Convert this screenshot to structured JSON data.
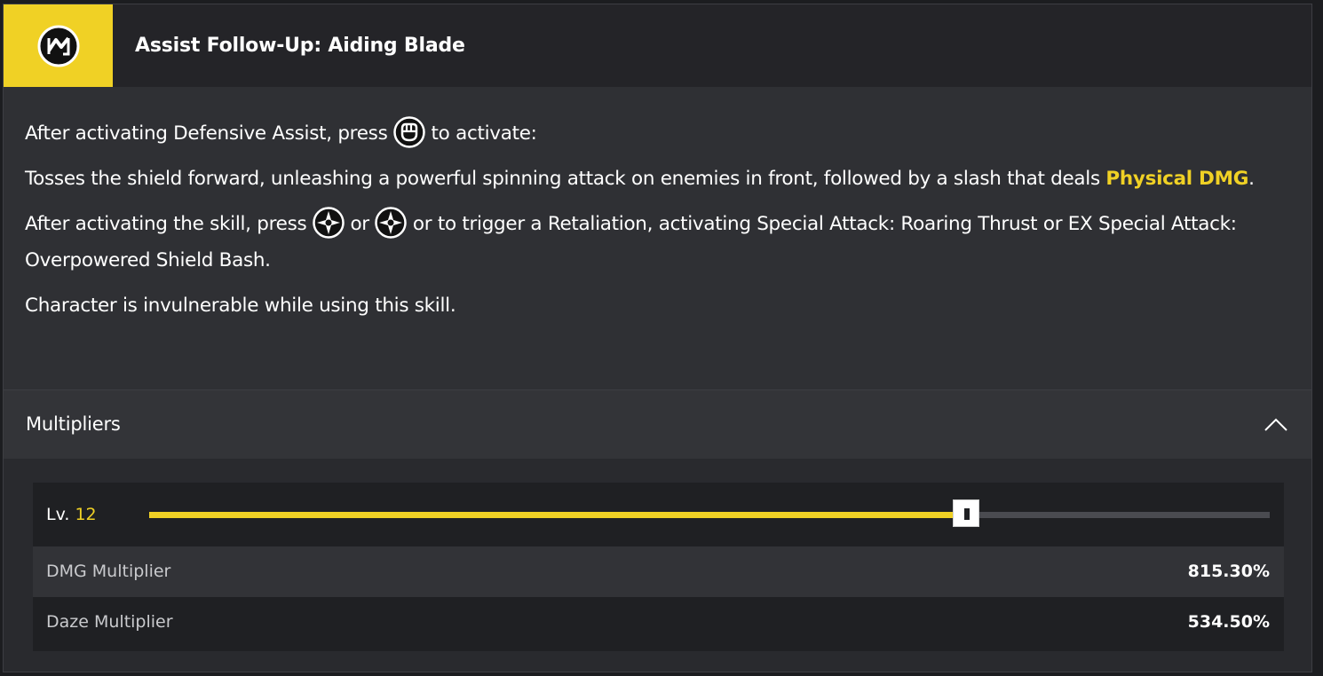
{
  "skill": {
    "icon": "assist-follow-up-icon",
    "title": "Assist Follow-Up: Aiding Blade"
  },
  "description": {
    "line1_before": "After activating Defensive Assist, press ",
    "line1_icon": "fist-button-icon",
    "line1_after": " to activate:",
    "line2_before": "Tosses the shield forward, unleashing a powerful spinning attack on enemies in front, followed by a slash that deals ",
    "line2_highlight": "Physical DMG",
    "line2_after": ".",
    "line3_before": "After activating the skill, press ",
    "line3_icon1": "special-attack-button-icon",
    "line3_mid": " or ",
    "line3_icon2": "special-attack-button-icon",
    "line3_after": " or to trigger a Retaliation, activating Special Attack: Roaring Thrust or EX Special Attack: Overpowered Shield Bash.",
    "line4": "Character is invulnerable while using this skill."
  },
  "multipliers": {
    "title": "Multipliers",
    "level_label": "Lv.",
    "level_value": "12",
    "level_fraction": 0.73,
    "rows": [
      {
        "label": "DMG Multiplier",
        "value": "815.30%"
      },
      {
        "label": "Daze Multiplier",
        "value": "534.50%"
      }
    ]
  },
  "colors": {
    "accent": "#f0d125",
    "background": "#2f3034",
    "header": "#242428"
  }
}
